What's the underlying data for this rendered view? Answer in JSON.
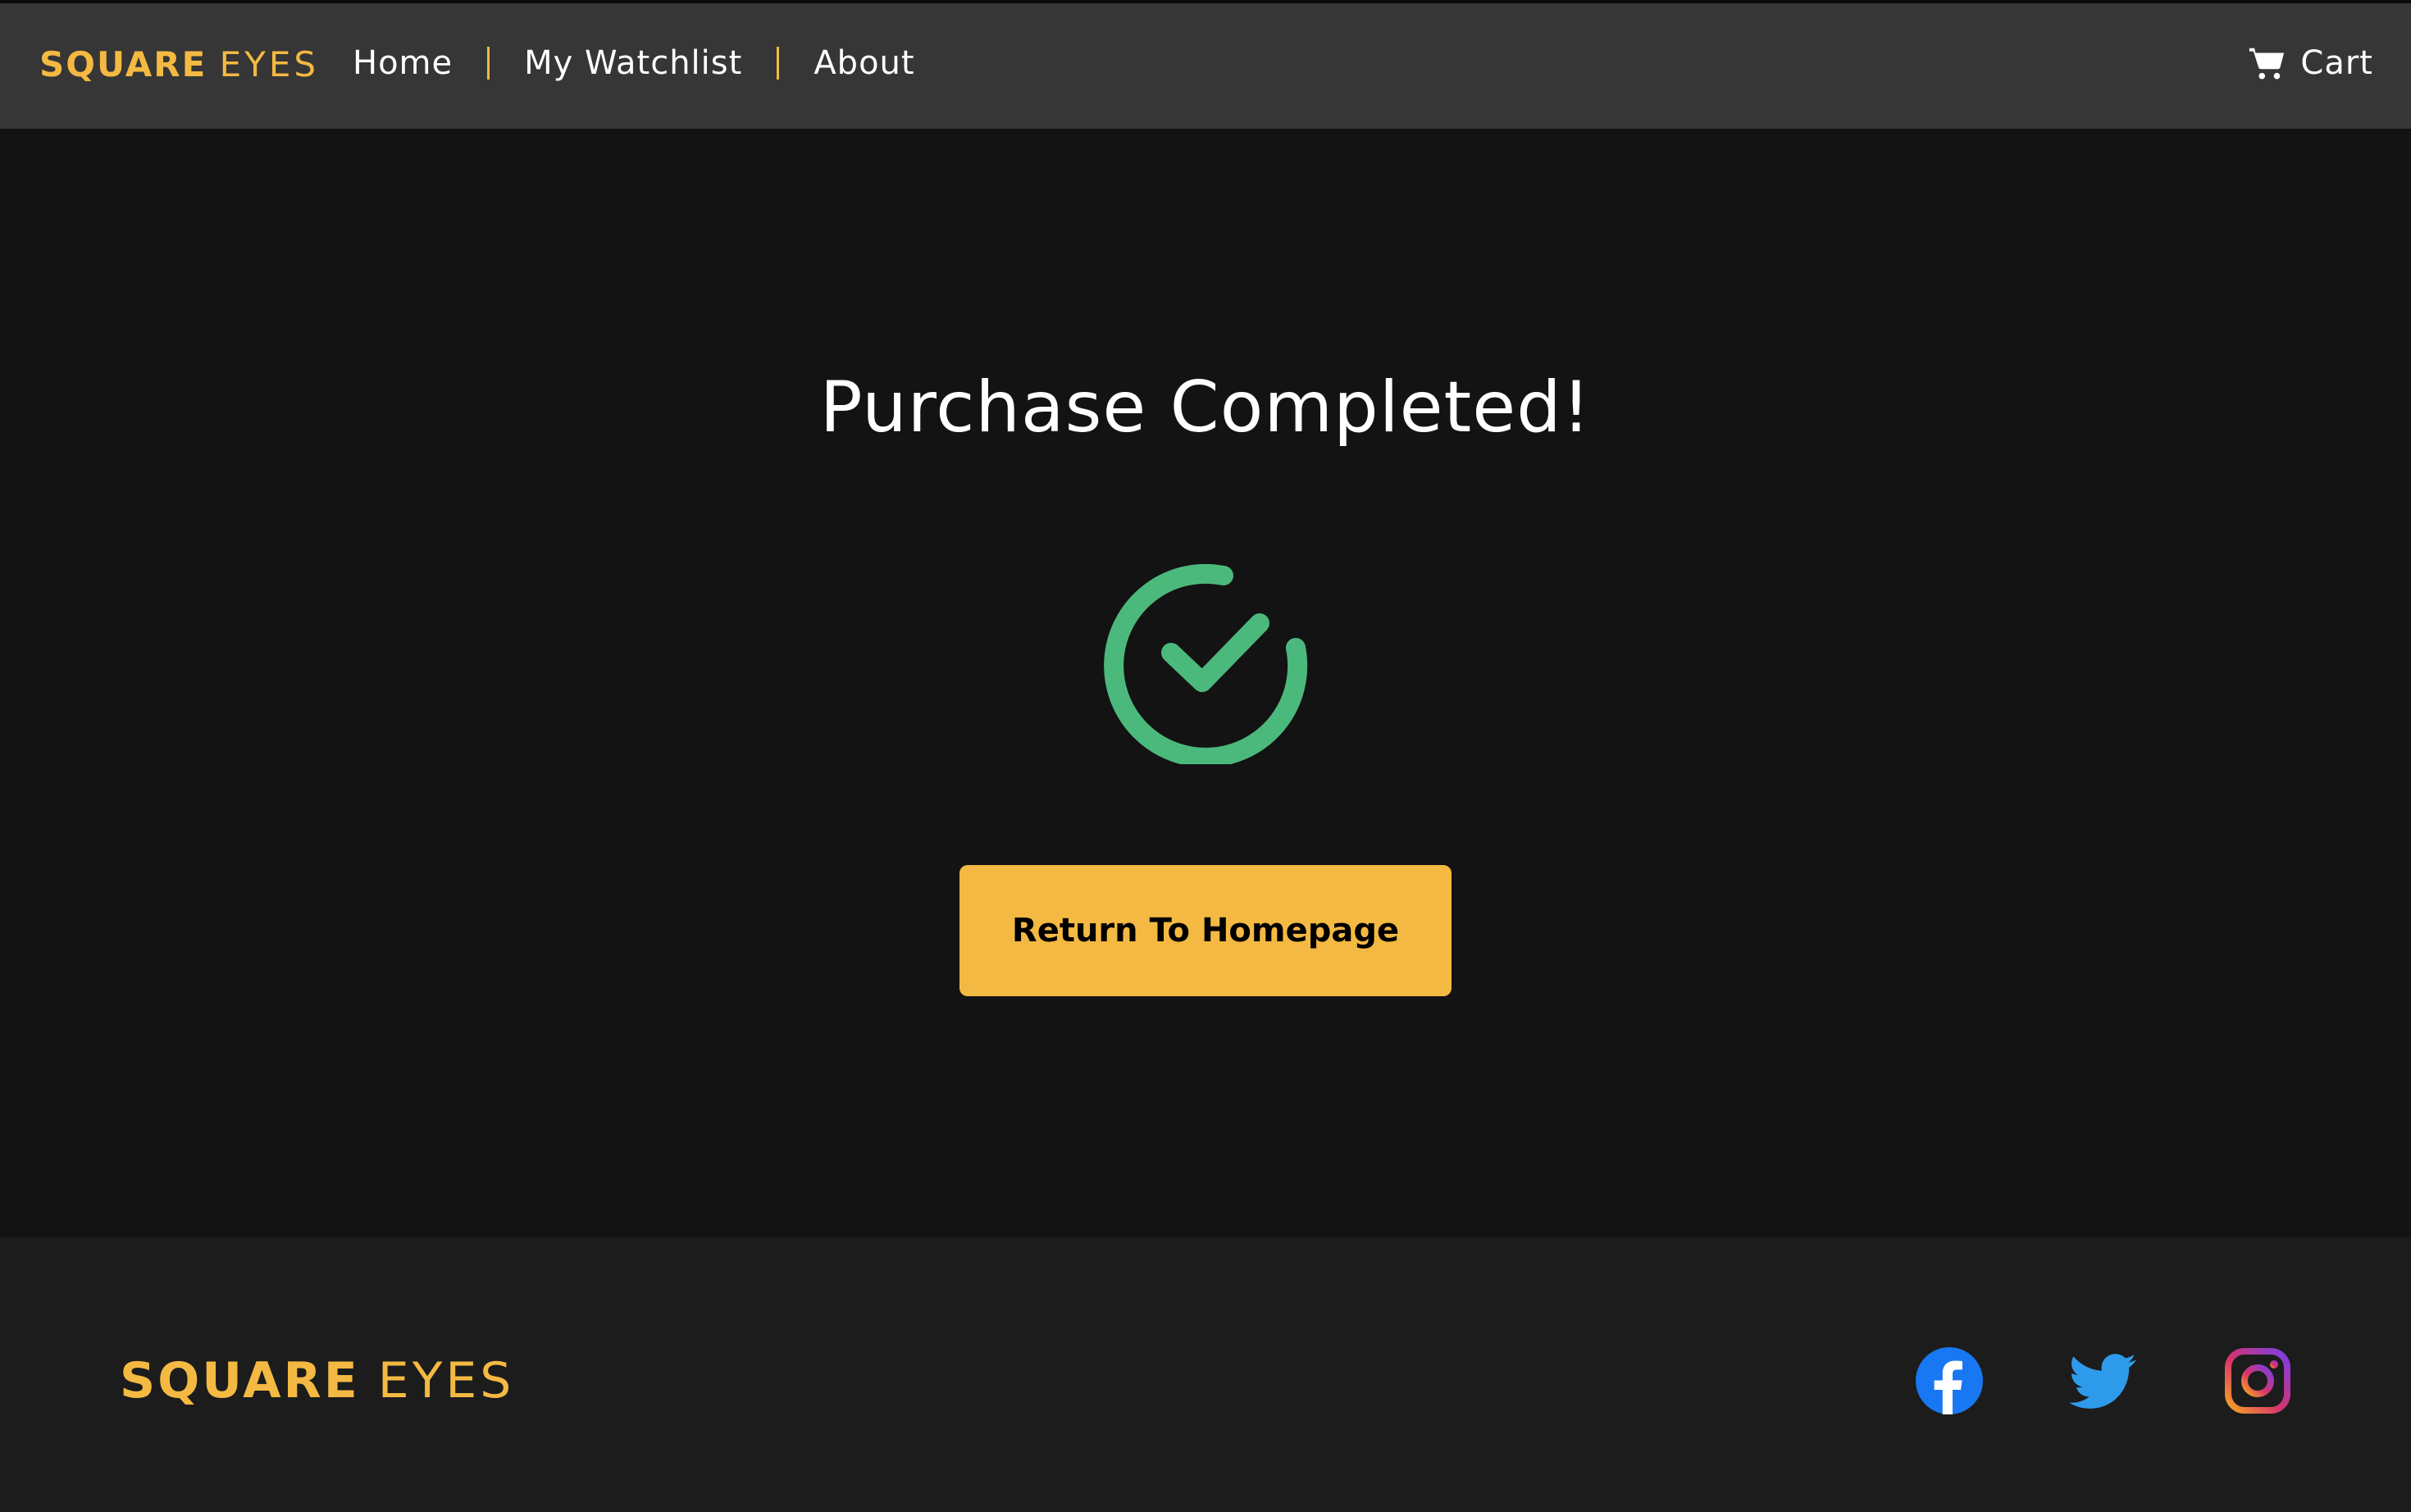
{
  "header": {
    "logo_bold": "SQUARE",
    "logo_light": "EYES",
    "nav": [
      {
        "label": "Home"
      },
      {
        "label": "My Watchlist"
      },
      {
        "label": "About"
      }
    ],
    "cart_label": "Cart"
  },
  "main": {
    "title": "Purchase Completed!",
    "button_label": "Return To Homepage"
  },
  "footer": {
    "logo_bold": "SQUARE",
    "logo_light": "EYES"
  },
  "colors": {
    "brand": "#f4b942",
    "header_bg": "#363636",
    "main_bg": "#131313",
    "footer_bg": "#1c1c1c",
    "success": "#4cb97c",
    "facebook": "#1877f2",
    "twitter": "#1d9bf0"
  },
  "icons": {
    "cart": "cart-icon",
    "success": "check-circle-icon",
    "facebook": "facebook-icon",
    "twitter": "twitter-icon",
    "instagram": "instagram-icon"
  }
}
